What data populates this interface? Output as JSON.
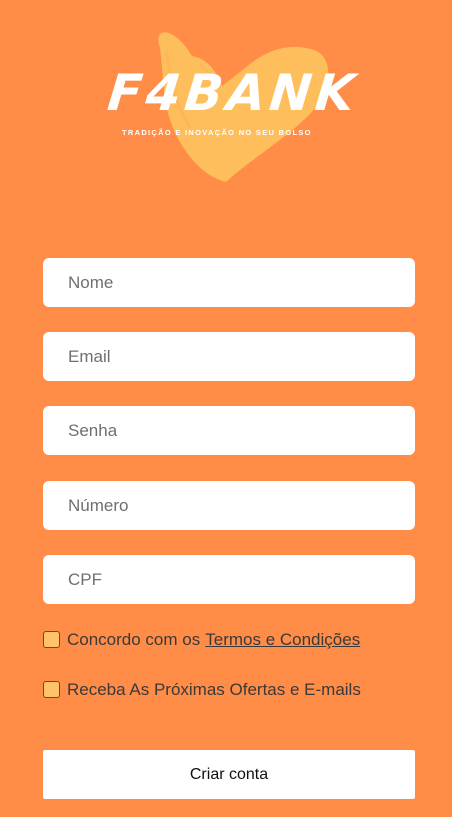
{
  "brand": {
    "name": "F4BANK",
    "tagline": "TRADIÇÃO E INOVAÇÃO NO SEU BOLSO"
  },
  "form": {
    "name_placeholder": "Nome",
    "email_placeholder": "Email",
    "password_placeholder": "Senha",
    "phone_placeholder": "Número",
    "cpf_placeholder": "CPF",
    "terms_text": "Concordo com os",
    "terms_link": "Termos e Condições",
    "offers_text": "Receba As Próximas Ofertas e E-mails",
    "submit_label": "Criar conta"
  },
  "colors": {
    "background": "#FF8C47",
    "heart": "#FFBE5C",
    "checkbox_fill": "#FFC36B"
  }
}
